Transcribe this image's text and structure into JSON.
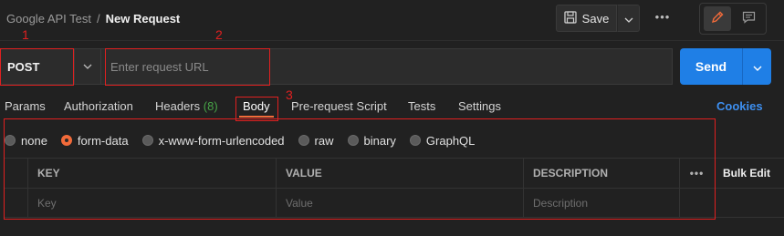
{
  "header": {
    "collection": "Google API Test",
    "separator": "/",
    "request_name": "New Request",
    "save_label": "Save",
    "more_label": "•••"
  },
  "request": {
    "method": "POST",
    "url_value": "",
    "url_placeholder": "Enter request URL",
    "send_label": "Send"
  },
  "tabs": [
    {
      "label": "Params"
    },
    {
      "label": "Authorization"
    },
    {
      "label": "Headers",
      "count": "(8)"
    },
    {
      "label": "Body",
      "active": true
    },
    {
      "label": "Pre-request Script"
    },
    {
      "label": "Tests"
    },
    {
      "label": "Settings"
    }
  ],
  "cookies_label": "Cookies",
  "body_types": [
    {
      "label": "none",
      "selected": false
    },
    {
      "label": "form-data",
      "selected": true
    },
    {
      "label": "x-www-form-urlencoded",
      "selected": false
    },
    {
      "label": "raw",
      "selected": false
    },
    {
      "label": "binary",
      "selected": false
    },
    {
      "label": "GraphQL",
      "selected": false
    }
  ],
  "table": {
    "headers": {
      "key": "KEY",
      "value": "VALUE",
      "description": "DESCRIPTION",
      "more": "•••",
      "bulk_edit": "Bulk Edit"
    },
    "placeholder_row": {
      "key": "Key",
      "value": "Value",
      "description": "Description"
    }
  },
  "annotations": [
    "1",
    "2",
    "3"
  ],
  "colors": {
    "accent": "#f26b3a",
    "send": "#1f7fe6",
    "link": "#3d8ff0",
    "count": "#47a447",
    "annotation": "#e02020"
  }
}
